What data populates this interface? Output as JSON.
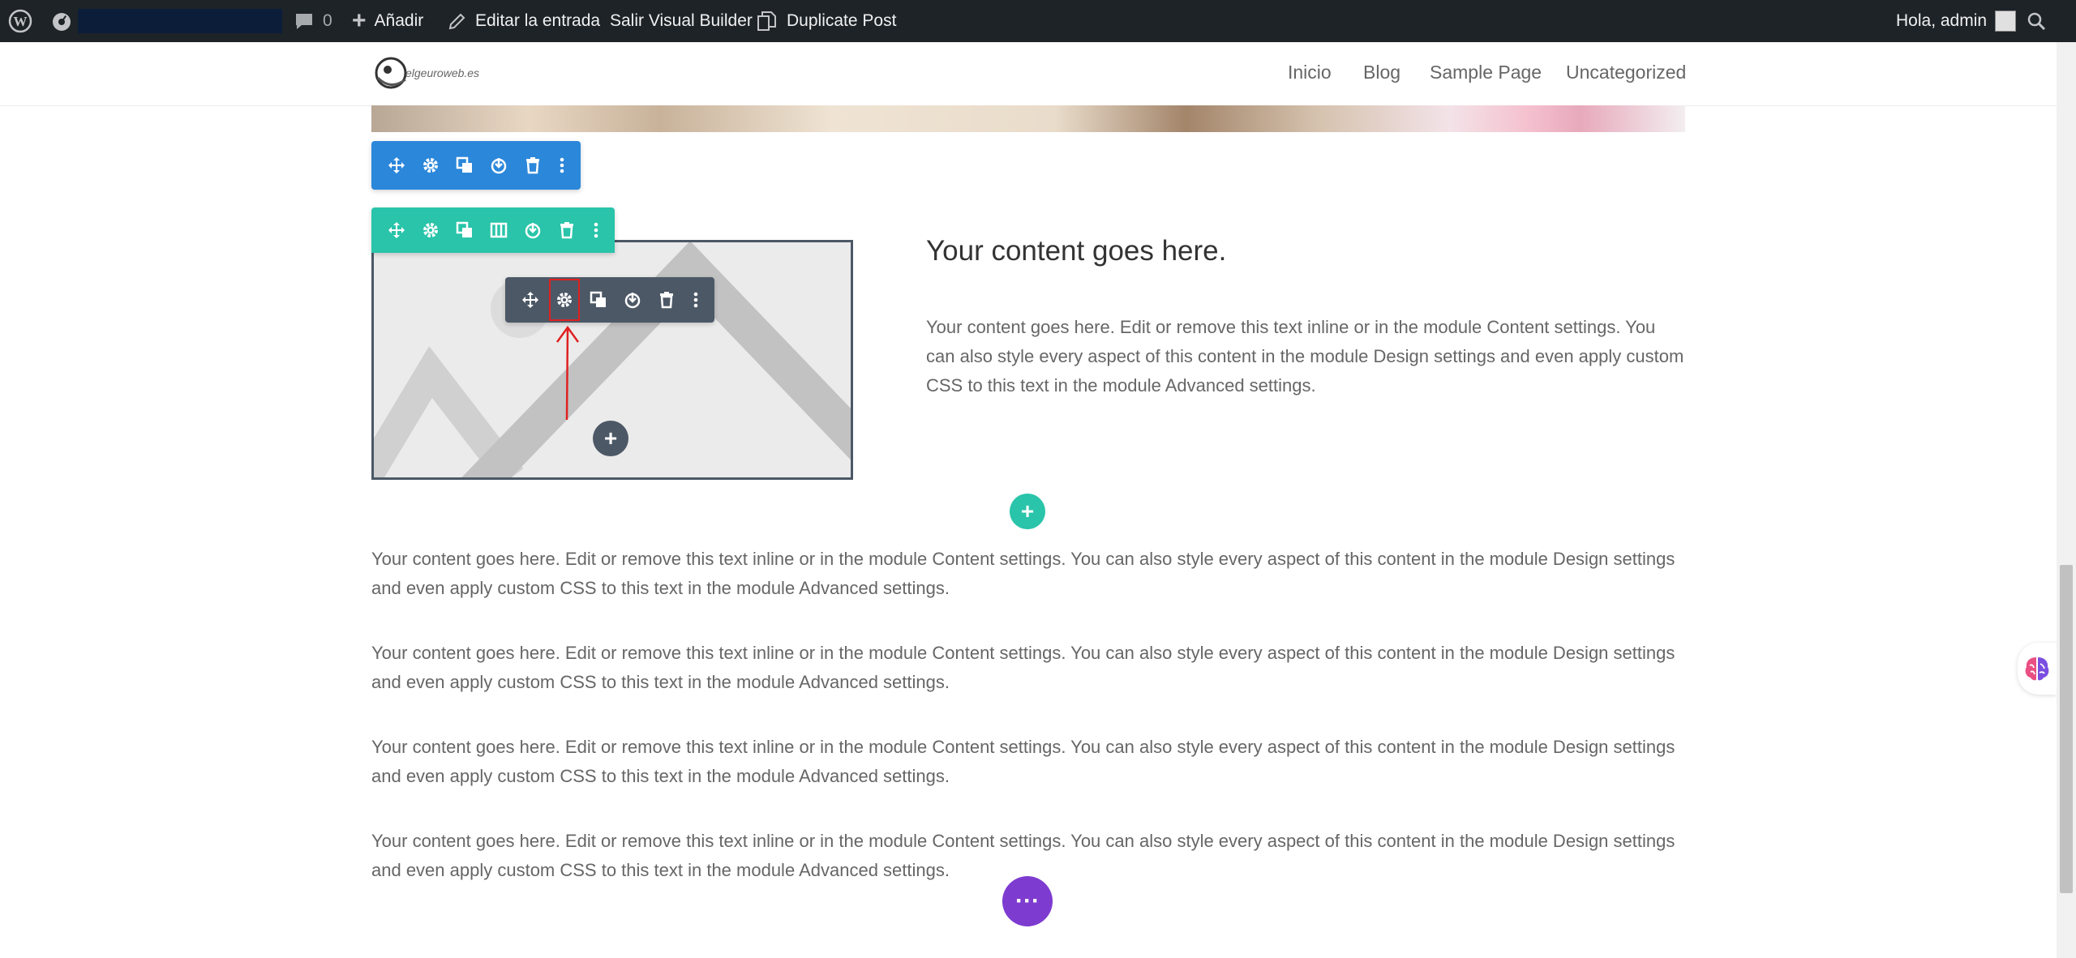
{
  "admin_bar": {
    "comment_count": "0",
    "add_new": "Añadir",
    "edit_post": "Editar la entrada",
    "exit_builder": "Salir Visual Builder",
    "duplicate_post": "Duplicate Post",
    "greeting": "Hola, admin"
  },
  "site": {
    "logo_text": "elgeuroweb.es"
  },
  "nav": {
    "items": [
      "Inicio",
      "Blog",
      "Sample Page",
      "Uncategorized"
    ]
  },
  "content": {
    "heading": "Your content goes here.",
    "column_text": "Your content goes here. Edit or remove this text inline or in the module Content settings. You can also style every aspect of this content in the module Design settings and even apply custom CSS to this text in the module Advanced settings.",
    "paragraphs": [
      "Your content goes here. Edit or remove this text inline or in the module Content settings. You can also style every aspect of this content in the module Design settings and even apply custom CSS to this text in the module Advanced settings.",
      "Your content goes here. Edit or remove this text inline or in the module Content settings. You can also style every aspect of this content in the module Design settings and even apply custom CSS to this text in the module Advanced settings.",
      "Your content goes here. Edit or remove this text inline or in the module Content settings. You can also style every aspect of this content in the module Design settings and even apply custom CSS to this text in the module Advanced settings.",
      "Your content goes here. Edit or remove this text inline or in the module Content settings. You can also style every aspect of this content in the module Design settings and even apply custom CSS to this text in the module Advanced settings."
    ]
  },
  "buttons": {
    "add_module": "+",
    "add_row": "+",
    "builder_menu": "···"
  },
  "colors": {
    "section_toolbar": "#2b87da",
    "row_toolbar": "#29c4a9",
    "module_toolbar": "#4c5866",
    "builder_menu": "#7e3bd0",
    "annotation": "#e02020"
  }
}
